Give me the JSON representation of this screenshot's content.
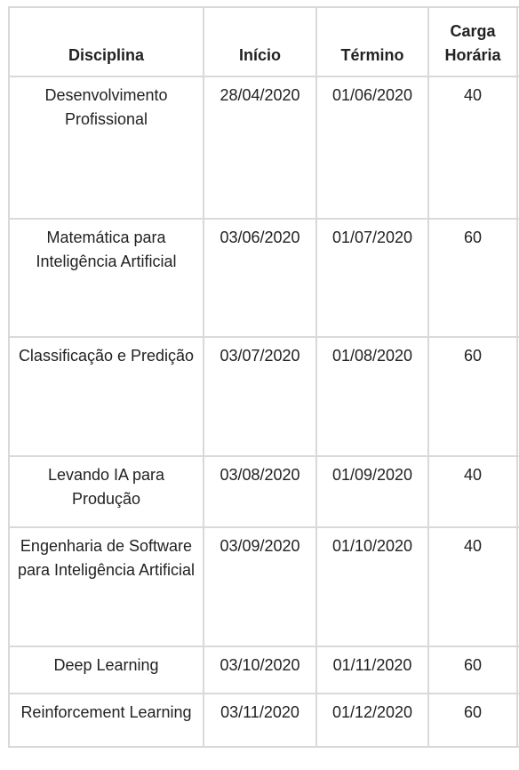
{
  "table": {
    "headers": [
      "Disciplina",
      "Início",
      "Término",
      "Carga Horária"
    ],
    "rows": [
      {
        "disciplina": "Desenvolvimento Profissional",
        "inicio": "28/04/2020",
        "termino": "01/06/2020",
        "carga": "40"
      },
      {
        "disciplina": "Matemática para Inteligência Artificial",
        "inicio": "03/06/2020",
        "termino": "01/07/2020",
        "carga": "60"
      },
      {
        "disciplina": "Classificação e Predição",
        "inicio": "03/07/2020",
        "termino": "01/08/2020",
        "carga": "60"
      },
      {
        "disciplina": "Levando IA para Produção",
        "inicio": "03/08/2020",
        "termino": "01/09/2020",
        "carga": "40"
      },
      {
        "disciplina": "Engenharia de Software para Inteligência Artificial",
        "inicio": "03/09/2020",
        "termino": "01/10/2020",
        "carga": "40"
      },
      {
        "disciplina": "Deep Learning",
        "inicio": "03/10/2020",
        "termino": "01/11/2020",
        "carga": "60"
      },
      {
        "disciplina": "Reinforcement Learning",
        "inicio": "03/11/2020",
        "termino": "01/12/2020",
        "carga": "60"
      }
    ]
  }
}
